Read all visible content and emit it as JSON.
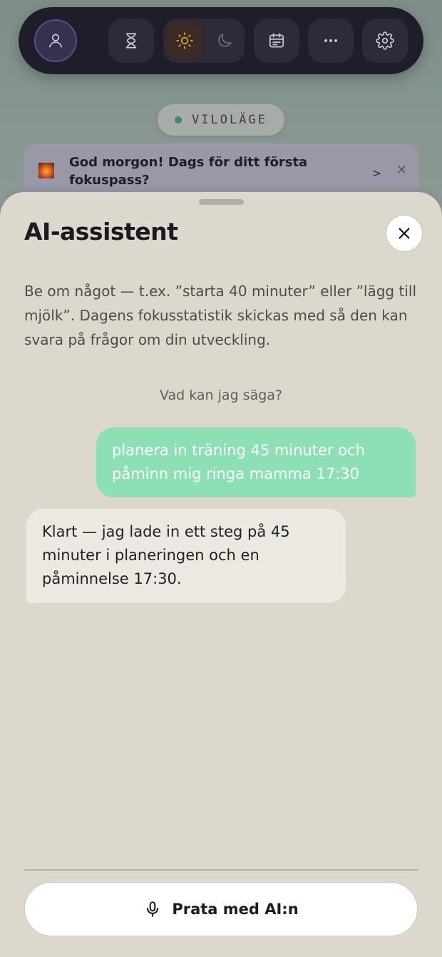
{
  "toolbar": {
    "buttons": [
      "profile-icon",
      "hourglass-icon",
      "sun-icon",
      "moon-icon",
      "calendar-icon",
      "more-icon",
      "gear-icon"
    ],
    "accent": "#e8a33a"
  },
  "status": {
    "label": "VILOLÄGE",
    "dot_color": "#3f8a6a"
  },
  "banner": {
    "text": "God morgon! Dags för ditt första fokuspass?",
    "chevron": ">",
    "close": "✕"
  },
  "sheet": {
    "title": "AI-assistent",
    "intro": "Be om något — t.ex. ”starta 40 minuter” eller ”lägg till mjölk”. Dagens fokusstatistik skickas med så den kan svara på frågor om din utveckling.",
    "hint": "Vad kan jag säga?",
    "messages": [
      {
        "role": "user",
        "text": "planera in träning 45 minuter och påminn mig ringa mamma 17:30"
      },
      {
        "role": "assistant",
        "text": "Klart — jag lade in ett steg på 45 minuter i planeringen och en påminnelse 17:30."
      }
    ],
    "talk_button": "Prata med AI:n"
  },
  "colors": {
    "user_bubble": "#8ce0b4",
    "sheet_bg": "#dcd8ce",
    "toolbar_bg": "#201d2a"
  }
}
